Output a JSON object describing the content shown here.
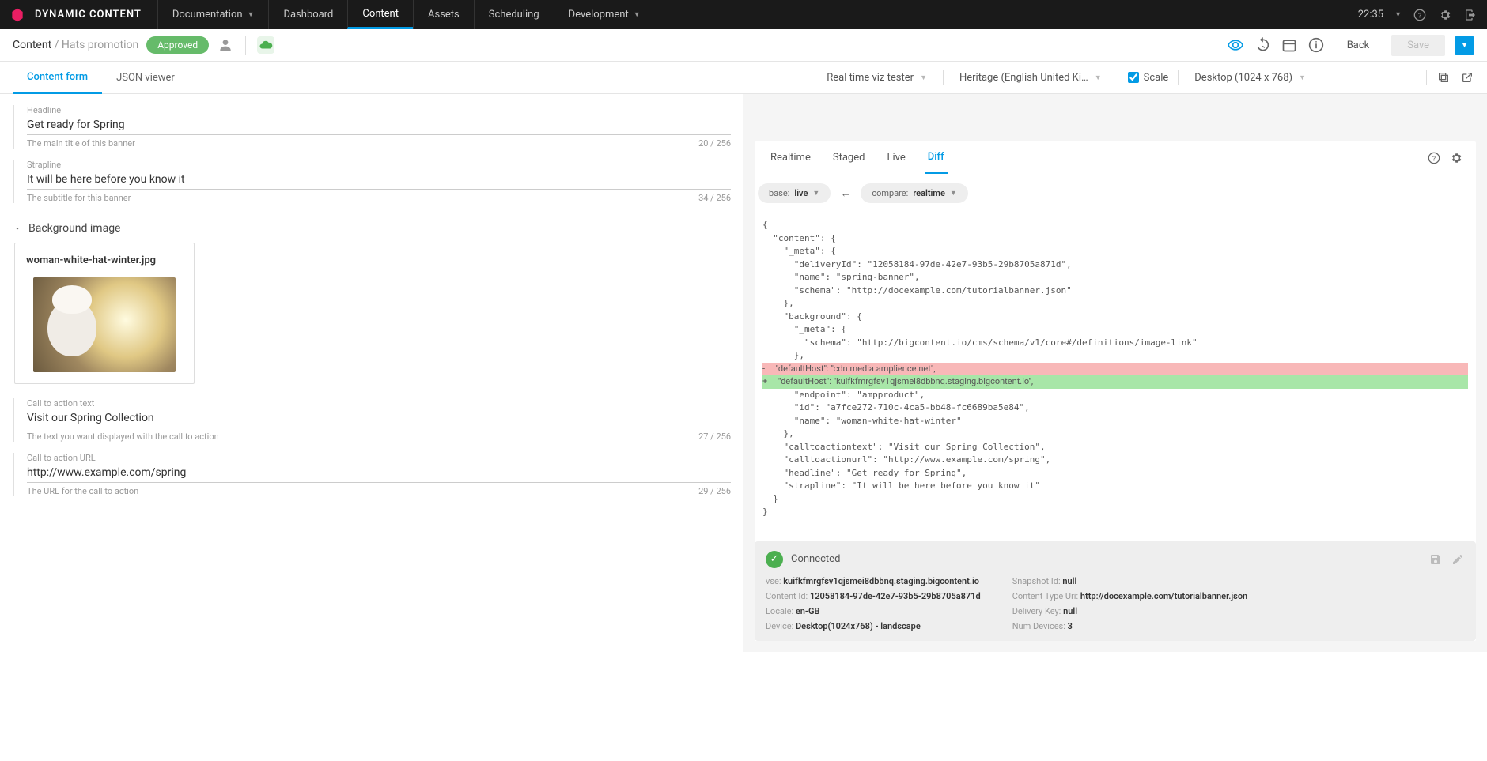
{
  "brand": "DYNAMIC CONTENT",
  "topnav": {
    "documentation": "Documentation",
    "dashboard": "Dashboard",
    "content": "Content",
    "assets": "Assets",
    "scheduling": "Scheduling",
    "development": "Development"
  },
  "clock": "22:35",
  "breadcrumb": {
    "root": "Content",
    "sep": "/",
    "current": "Hats promotion"
  },
  "status_chip": "Approved",
  "actions": {
    "back": "Back",
    "save": "Save"
  },
  "tabs": {
    "form": "Content form",
    "json": "JSON viewer"
  },
  "preview_controls": {
    "viz": "Real time viz tester",
    "locale": "Heritage (English United Ki…",
    "scale_label": "Scale",
    "device": "Desktop (1024 x 768)"
  },
  "fields": {
    "headline": {
      "label": "Headline",
      "value": "Get ready for Spring",
      "help": "The main title of this banner",
      "count": "20 / 256"
    },
    "strapline": {
      "label": "Strapline",
      "value": "It will be here before you know it",
      "help": "The subtitle for this banner",
      "count": "34 / 256"
    },
    "bg_section": "Background image",
    "image_name": "woman-white-hat-winter.jpg",
    "cta_text": {
      "label": "Call to action text",
      "value": "Visit our Spring Collection",
      "help": "The text you want displayed with the call to action",
      "count": "27 / 256"
    },
    "cta_url": {
      "label": "Call to action URL",
      "value": "http://www.example.com/spring",
      "help": "The URL for the call to action",
      "count": "29 / 256"
    }
  },
  "diff_tabs": {
    "realtime": "Realtime",
    "staged": "Staged",
    "live": "Live",
    "diff": "Diff"
  },
  "compare": {
    "base_label": "base:",
    "base_val": "live",
    "compare_label": "compare:",
    "compare_val": "realtime"
  },
  "diff_lines": [
    "{",
    "  \"content\": {",
    "    \"_meta\": {",
    "      \"deliveryId\": \"12058184-97de-42e7-93b5-29b8705a871d\",",
    "      \"name\": \"spring-banner\",",
    "      \"schema\": \"http://docexample.com/tutorialbanner.json\"",
    "    },",
    "    \"background\": {",
    "      \"_meta\": {",
    "        \"schema\": \"http://bigcontent.io/cms/schema/v1/core#/definitions/image-link\"",
    "      },"
  ],
  "diff_del": "-     \"defaultHost\": \"cdn.media.amplience.net\",",
  "diff_add": "+     \"defaultHost\": \"kuifkfmrgfsv1qjsmei8dbbnq.staging.bigcontent.io\",",
  "diff_lines2": [
    "      \"endpoint\": \"ampproduct\",",
    "      \"id\": \"a7fce272-710c-4ca5-bb48-fc6689ba5e84\",",
    "      \"name\": \"woman-white-hat-winter\"",
    "    },",
    "    \"calltoactiontext\": \"Visit our Spring Collection\",",
    "    \"calltoactionurl\": \"http://www.example.com/spring\",",
    "    \"headline\": \"Get ready for Spring\",",
    "    \"strapline\": \"It will be here before you know it\"",
    "  }",
    "}"
  ],
  "status": {
    "connected": "Connected",
    "vse_k": "vse:",
    "vse_v": "kuifkfmrgfsv1qjsmei8dbbnq.staging.bigcontent.io",
    "cid_k": "Content Id:",
    "cid_v": "12058184-97de-42e7-93b5-29b8705a871d",
    "loc_k": "Locale:",
    "loc_v": "en-GB",
    "dev_k": "Device:",
    "dev_v": "Desktop(1024x768) - landscape",
    "snap_k": "Snapshot Id:",
    "snap_v": "null",
    "ctu_k": "Content Type Uri:",
    "ctu_v": "http://docexample.com/tutorialbanner.json",
    "dk_k": "Delivery Key:",
    "dk_v": "null",
    "nd_k": "Num Devices:",
    "nd_v": "3"
  }
}
